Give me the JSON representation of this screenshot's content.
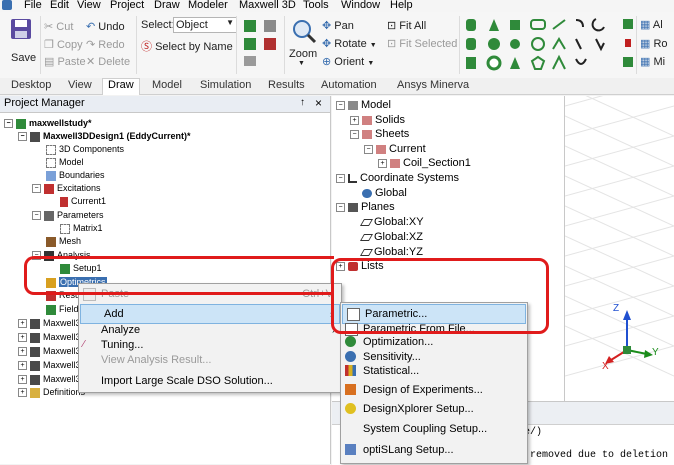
{
  "menubar": {
    "items": [
      "File",
      "Edit",
      "View",
      "Project",
      "Draw",
      "Modeler",
      "Maxwell 3D",
      "Tools",
      "Window",
      "Help"
    ]
  },
  "ribbon": {
    "save": "Save",
    "cut": "Cut",
    "copy": "Copy",
    "paste": "Paste",
    "undo": "Undo",
    "redo": "Redo",
    "delete": "Delete",
    "select_label": "Select:",
    "select_value": "Object",
    "select_by_name": "Select by Name",
    "zoom": "Zoom",
    "pan": "Pan",
    "rotate": "Rotate",
    "orient": "Orient",
    "fit_all": "Fit All",
    "fit_selected": "Fit Selected",
    "right_fragment_1": "Al",
    "right_fragment_2": "Ro",
    "right_fragment_3": "Mi"
  },
  "tabs": [
    "Desktop",
    "View",
    "Draw",
    "Model",
    "Simulation",
    "Results",
    "Automation",
    "Ansys Minerva"
  ],
  "active_tab": "Draw",
  "project_manager": {
    "title": "Project Manager",
    "pin": "↑",
    "close": "×",
    "tree": [
      {
        "label": "maxwellstudy*",
        "bold": true
      },
      {
        "label": "Maxwell3DDesign1 (EddyCurrent)*",
        "bold": true
      },
      {
        "label": "3D Components"
      },
      {
        "label": "Model"
      },
      {
        "label": "Boundaries"
      },
      {
        "label": "Excitations"
      },
      {
        "label": "Current1"
      },
      {
        "label": "Parameters"
      },
      {
        "label": "Matrix1"
      },
      {
        "label": "Mesh"
      },
      {
        "label": "Analysis"
      },
      {
        "label": "Setup1"
      },
      {
        "label": "Optimetrics"
      },
      {
        "label": "Resul"
      },
      {
        "label": "Field"
      },
      {
        "label": "Maxwell3"
      },
      {
        "label": "Maxwell3"
      },
      {
        "label": "Maxwell3"
      },
      {
        "label": "Maxwell3"
      },
      {
        "label": "Maxwell3"
      },
      {
        "label": "Definitions"
      }
    ]
  },
  "model_tree": [
    {
      "label": "Model"
    },
    {
      "label": "Solids"
    },
    {
      "label": "Sheets"
    },
    {
      "label": "Current"
    },
    {
      "label": "Coil_Section1"
    },
    {
      "label": "Coordinate Systems"
    },
    {
      "label": "Global"
    },
    {
      "label": "Planes"
    },
    {
      "label": "Global:XY"
    },
    {
      "label": "Global:XZ"
    },
    {
      "label": "Global:YZ"
    },
    {
      "label": "Lists"
    }
  ],
  "context_menu": {
    "items": [
      {
        "label": "Paste",
        "shortcut": "Ctrl+V",
        "disabled": true
      },
      {
        "label": "Add",
        "submenu": true,
        "highlighted": true
      },
      {
        "label": "Analyze",
        "submenu": true
      },
      {
        "label": "Tuning..."
      },
      {
        "label": "View Analysis Result...",
        "disabled": true
      },
      {
        "label": "Import Large Scale DSO Solution..."
      }
    ]
  },
  "submenu": {
    "items": [
      {
        "label": "Parametric...",
        "highlighted": true
      },
      {
        "label": "Parametric From File..."
      },
      {
        "label": "Optimization..."
      },
      {
        "label": "Sensitivity..."
      },
      {
        "label": "Statistical..."
      },
      {
        "label": "Design of Experiments..."
      },
      {
        "label": "DesignXplorer Setup..."
      },
      {
        "label": "System Coupling Setup..."
      },
      {
        "label": "optiSLang Setup..."
      }
    ]
  },
  "messages": {
    "line1": "se/)",
    "line2": "n removed due to deletion of"
  },
  "axes": {
    "z": "Z",
    "y": "Y",
    "x": "X"
  },
  "colors": {
    "highlight_red": "#e01b1b",
    "menu_highlight": "#cce4f7",
    "axis_x": "#d42020",
    "axis_y": "#1a8c1a",
    "axis_z": "#2050d0"
  }
}
